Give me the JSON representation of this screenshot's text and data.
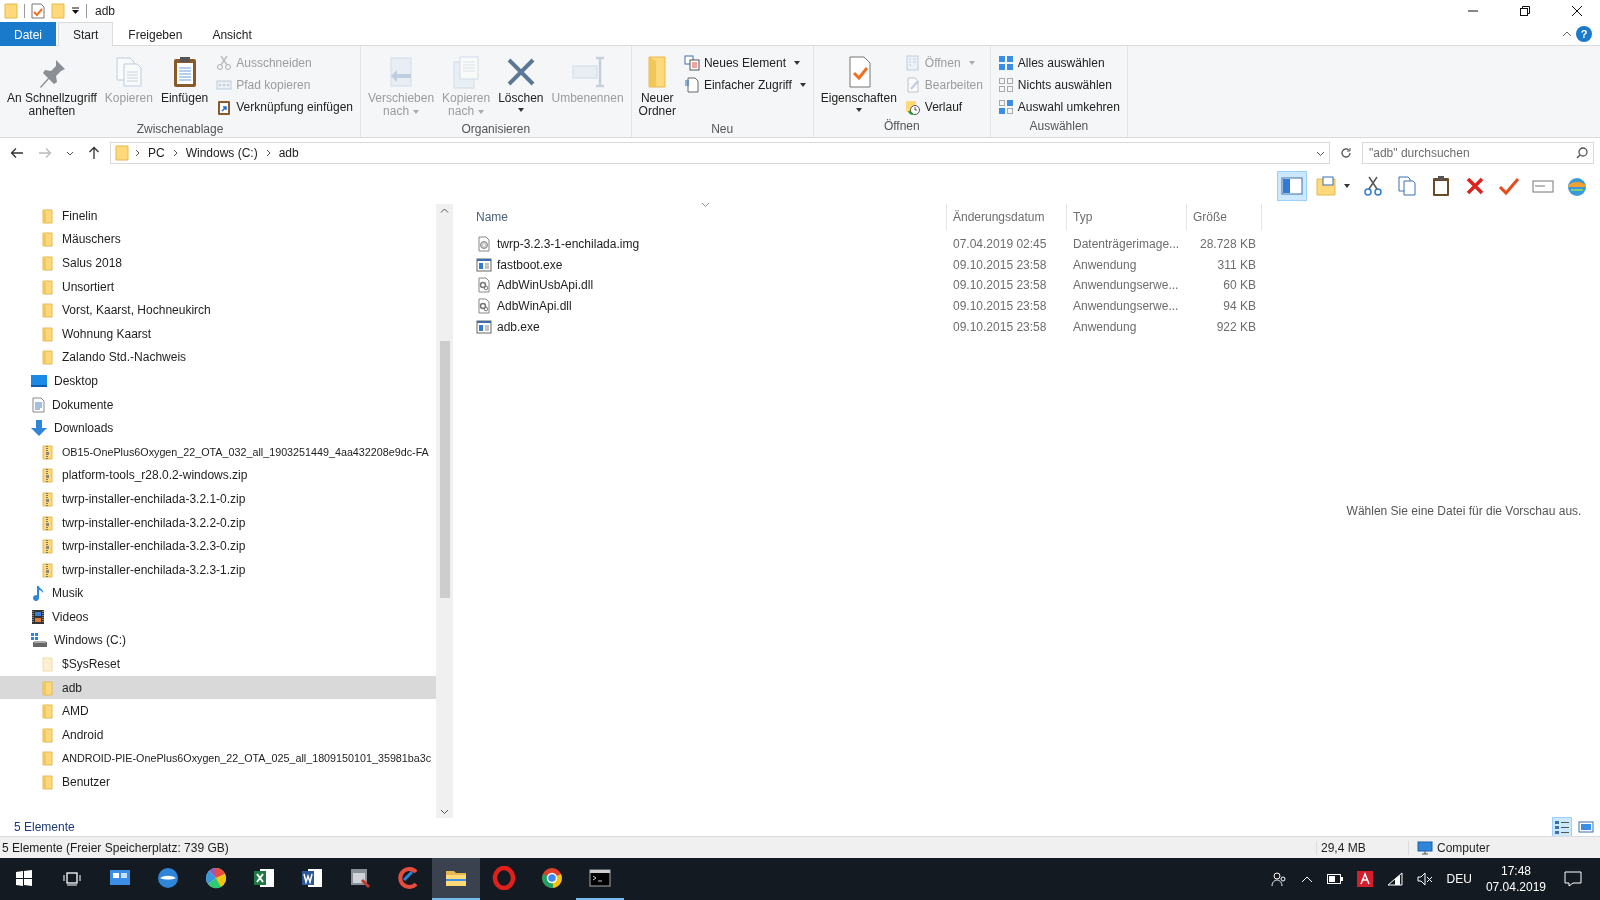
{
  "window": {
    "title": "adb",
    "help_button": "?"
  },
  "ribbon": {
    "tabs": [
      {
        "label": "Datei",
        "kind": "menu",
        "selected": false
      },
      {
        "label": "Start",
        "kind": "tab",
        "selected": true
      },
      {
        "label": "Freigeben",
        "kind": "tab",
        "selected": false
      },
      {
        "label": "Ansicht",
        "kind": "tab",
        "selected": false
      }
    ],
    "groups": [
      {
        "label": "Zwischenablage",
        "commands": [
          {
            "kind": "large",
            "lines": [
              "An Schnellzugriff",
              "anheften"
            ],
            "disabled": false,
            "dropdown": false
          },
          {
            "kind": "large",
            "lines": [
              "Kopieren"
            ],
            "disabled": true,
            "dropdown": false
          },
          {
            "kind": "large",
            "lines": [
              "Einfügen"
            ],
            "disabled": false,
            "dropdown": false
          },
          {
            "kind": "small",
            "lines": [
              "Ausschneiden"
            ],
            "disabled": true,
            "dropdown": false
          },
          {
            "kind": "small",
            "lines": [
              "Pfad kopieren"
            ],
            "disabled": true,
            "dropdown": false
          },
          {
            "kind": "small",
            "lines": [
              "Verknüpfung einfügen"
            ],
            "disabled": false,
            "dropdown": false
          }
        ]
      },
      {
        "label": "Organisieren",
        "commands": [
          {
            "kind": "large",
            "lines": [
              "Verschieben",
              "nach"
            ],
            "disabled": true,
            "dropdown": true
          },
          {
            "kind": "large",
            "lines": [
              "Kopieren",
              "nach"
            ],
            "disabled": true,
            "dropdown": true
          },
          {
            "kind": "large",
            "lines": [
              "Löschen"
            ],
            "disabled": false,
            "dropdown": true
          },
          {
            "kind": "large",
            "lines": [
              "Umbenennen"
            ],
            "disabled": true,
            "dropdown": false
          }
        ]
      },
      {
        "label": "Neu",
        "commands": [
          {
            "kind": "large",
            "lines": [
              "Neuer",
              "Ordner"
            ],
            "disabled": false,
            "dropdown": false
          },
          {
            "kind": "small",
            "lines": [
              "Neues Element"
            ],
            "disabled": false,
            "dropdown": true
          },
          {
            "kind": "small",
            "lines": [
              "Einfacher Zugriff"
            ],
            "disabled": false,
            "dropdown": true
          }
        ]
      },
      {
        "label": "Öffnen",
        "commands": [
          {
            "kind": "large",
            "lines": [
              "Eigenschaften"
            ],
            "disabled": false,
            "dropdown": true
          },
          {
            "kind": "small",
            "lines": [
              "Öffnen"
            ],
            "disabled": true,
            "dropdown": true
          },
          {
            "kind": "small",
            "lines": [
              "Bearbeiten"
            ],
            "disabled": true,
            "dropdown": false
          },
          {
            "kind": "small",
            "lines": [
              "Verlauf"
            ],
            "disabled": false,
            "dropdown": false
          }
        ]
      },
      {
        "label": "Auswählen",
        "commands": [
          {
            "kind": "small",
            "lines": [
              "Alles auswählen"
            ],
            "disabled": false,
            "dropdown": false
          },
          {
            "kind": "small",
            "lines": [
              "Nichts auswählen"
            ],
            "disabled": false,
            "dropdown": false
          },
          {
            "kind": "small",
            "lines": [
              "Auswahl umkehren"
            ],
            "disabled": false,
            "dropdown": false
          }
        ]
      }
    ]
  },
  "address_bar": {
    "breadcrumbs": [
      "PC",
      "Windows (C:)",
      "adb"
    ],
    "search": {
      "placeholder": "\"adb\" durchsuchen"
    }
  },
  "toolbar": {
    "buttons": [
      {
        "kind": "preview-pane",
        "pressed": true,
        "dropdown": false
      },
      {
        "kind": "new-folder",
        "pressed": false,
        "dropdown": true
      },
      {
        "kind": "cut",
        "pressed": false,
        "dropdown": false
      },
      {
        "kind": "copy",
        "pressed": false,
        "dropdown": false
      },
      {
        "kind": "paste",
        "pressed": false,
        "dropdown": false
      },
      {
        "kind": "delete",
        "pressed": false,
        "dropdown": false
      },
      {
        "kind": "confirm",
        "pressed": false,
        "dropdown": false
      },
      {
        "kind": "rename",
        "pressed": false,
        "dropdown": false
      },
      {
        "kind": "globe",
        "pressed": false,
        "dropdown": false
      }
    ]
  },
  "tree": {
    "continued_children": [
      {
        "label": "Finelin",
        "kind": "folder",
        "selected": false
      },
      {
        "label": "Mäuschers",
        "kind": "folder",
        "selected": false
      },
      {
        "label": "Salus 2018",
        "kind": "folder",
        "selected": false
      },
      {
        "label": "Unsortiert",
        "kind": "folder",
        "selected": false
      },
      {
        "label": "Vorst, Kaarst, Hochneukirch",
        "kind": "folder",
        "selected": false
      },
      {
        "label": "Wohnung Kaarst",
        "kind": "folder",
        "selected": false
      },
      {
        "label": "Zalando Std.-Nachweis",
        "kind": "folder",
        "selected": false
      }
    ],
    "items": [
      {
        "label": "Desktop",
        "kind": "desktop",
        "selected": false
      },
      {
        "label": "Dokumente",
        "kind": "documents",
        "selected": false
      },
      {
        "label": "Downloads",
        "kind": "downloads",
        "selected": false,
        "children": [
          {
            "label": "OB15-OnePlus6Oxygen_22_OTA_032_all_1903251449_4aa432208e9dc-FA",
            "kind": "zip",
            "selected": false
          },
          {
            "label": "platform-tools_r28.0.2-windows.zip",
            "kind": "zip",
            "selected": false
          },
          {
            "label": "twrp-installer-enchilada-3.2.1-0.zip",
            "kind": "zip",
            "selected": false
          },
          {
            "label": "twrp-installer-enchilada-3.2.2-0.zip",
            "kind": "zip",
            "selected": false
          },
          {
            "label": "twrp-installer-enchilada-3.2.3-0.zip",
            "kind": "zip",
            "selected": false
          },
          {
            "label": "twrp-installer-enchilada-3.2.3-1.zip",
            "kind": "zip",
            "selected": false
          }
        ]
      },
      {
        "label": "Musik",
        "kind": "music",
        "selected": false
      },
      {
        "label": "Videos",
        "kind": "videos",
        "selected": false
      },
      {
        "label": "Windows (C:)",
        "kind": "drive",
        "selected": false,
        "children": [
          {
            "label": "$SysReset",
            "kind": "hidden-folder",
            "selected": false
          },
          {
            "label": "adb",
            "kind": "folder",
            "selected": true
          },
          {
            "label": "AMD",
            "kind": "folder",
            "selected": false
          },
          {
            "label": "Android",
            "kind": "folder",
            "selected": false
          },
          {
            "label": "ANDROID-PIE-OnePlus6Oxygen_22_OTA_025_all_1809150101_35981ba3c",
            "kind": "folder",
            "selected": false
          },
          {
            "label": "Benutzer",
            "kind": "folder",
            "selected": false
          }
        ]
      }
    ]
  },
  "files": {
    "columns": [
      "Name",
      "Änderungsdatum",
      "Typ",
      "Größe"
    ],
    "rows": [
      {
        "name": "twrp-3.2.3-1-enchilada.img",
        "date": "07.04.2019 02:45",
        "type": "Datenträgerimage...",
        "size": "28.728 KB",
        "kind": "image",
        "selected": false
      },
      {
        "name": "fastboot.exe",
        "date": "09.10.2015 23:58",
        "type": "Anwendung",
        "size": "311 KB",
        "kind": "exe",
        "selected": false
      },
      {
        "name": "AdbWinUsbApi.dll",
        "date": "09.10.2015 23:58",
        "type": "Anwendungserwe...",
        "size": "60 KB",
        "kind": "dll",
        "selected": false
      },
      {
        "name": "AdbWinApi.dll",
        "date": "09.10.2015 23:58",
        "type": "Anwendungserwe...",
        "size": "94 KB",
        "kind": "dll",
        "selected": false
      },
      {
        "name": "adb.exe",
        "date": "09.10.2015 23:58",
        "type": "Anwendung",
        "size": "922 KB",
        "kind": "exe",
        "selected": false
      }
    ]
  },
  "preview": {
    "message": "Wählen Sie eine Datei für die Vorschau aus."
  },
  "item_count": "5 Elemente",
  "view_buttons": [
    {
      "kind": "details",
      "selected": true
    },
    {
      "kind": "large-icons",
      "selected": false
    }
  ],
  "status_bar": {
    "summary": "5 Elemente (Freier Speicherplatz: 739 GB)",
    "size": "29,4 MB",
    "location": "Computer"
  },
  "taskbar": {
    "apps": [
      {
        "kind": "control-panel",
        "running": false,
        "active": false
      },
      {
        "kind": "bird",
        "running": false,
        "active": false
      },
      {
        "kind": "pinwheel",
        "running": false,
        "active": false
      },
      {
        "kind": "spreadsheet",
        "running": false,
        "active": false
      },
      {
        "kind": "word-processor",
        "running": false,
        "active": false
      },
      {
        "kind": "window-tool",
        "running": false,
        "active": false
      },
      {
        "kind": "cleaner",
        "running": false,
        "active": false
      },
      {
        "kind": "explorer",
        "running": true,
        "active": true
      },
      {
        "kind": "ring",
        "running": false,
        "active": false
      },
      {
        "kind": "browser",
        "running": false,
        "active": false
      },
      {
        "kind": "terminal",
        "running": true,
        "active": false
      }
    ],
    "language": "DEU",
    "time": "17:48",
    "date": "07.04.2019"
  }
}
